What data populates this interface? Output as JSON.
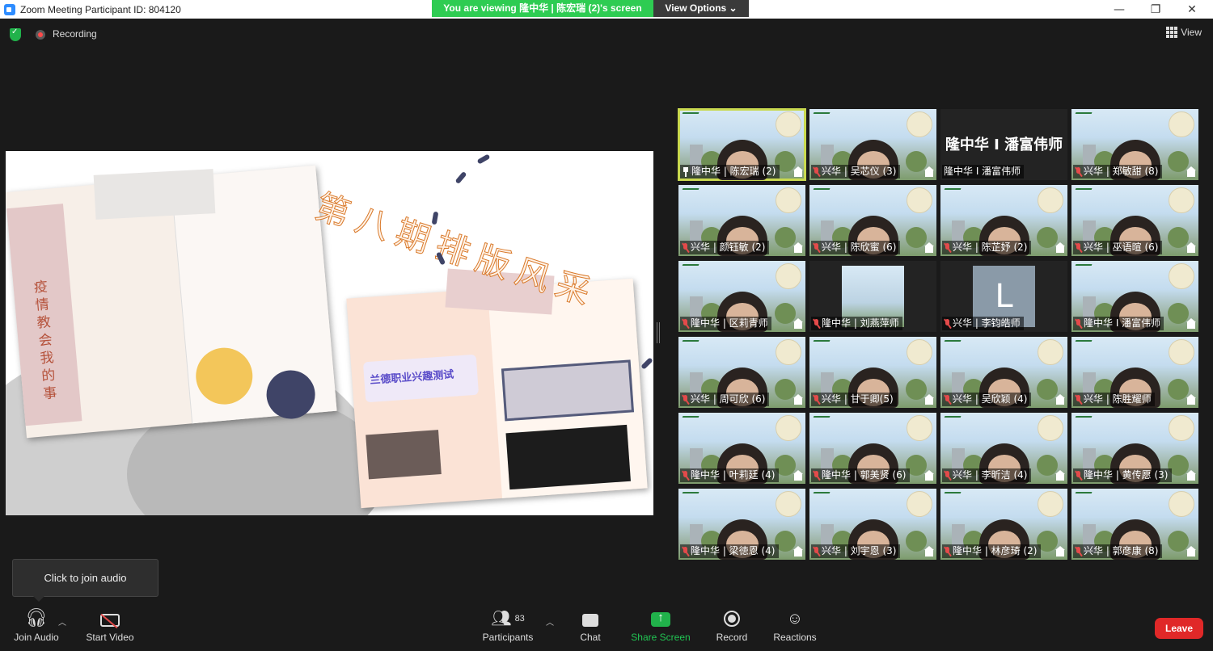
{
  "window": {
    "title": "Zoom Meeting Participant ID: 804120",
    "viewing_banner": "You are viewing 隆中华 | 陈宏瑞 (2)'s screen",
    "view_options": "View Options ⌄",
    "minimize": "—",
    "restore": "❐",
    "close": "✕"
  },
  "status": {
    "recording": "Recording",
    "view": "View"
  },
  "shared_screen": {
    "headline": "第八期排版风采",
    "left_vertical_text": "疫情教会我的事",
    "right_title": "兰德职业兴趣测试"
  },
  "gallery": [
    {
      "label": "隆中华 | 陈宏瑞 (2)",
      "type": "video",
      "icon": "pin",
      "selected": true
    },
    {
      "label": "兴华 | 吴芯仪 (3)",
      "type": "video",
      "icon": "muted"
    },
    {
      "label": "隆中华 I 潘富伟师",
      "type": "name",
      "big": "隆中华 I 潘富伟师"
    },
    {
      "label": "兴华 | 郑敏甜 (8)",
      "type": "video",
      "icon": "muted"
    },
    {
      "label": "兴华 | 颜钰敏 (2)",
      "type": "video",
      "icon": "muted"
    },
    {
      "label": "兴华 | 陈欣蜜 (6)",
      "type": "video",
      "icon": "muted"
    },
    {
      "label": "兴华 | 陈芷妤 (2)",
      "type": "video",
      "icon": "muted"
    },
    {
      "label": "兴华 | 巫语暄 (6)",
      "type": "video",
      "icon": "muted"
    },
    {
      "label": "隆中华 | 区莉青师",
      "type": "video",
      "icon": "muted"
    },
    {
      "label": "隆中华 | 刘燕萍师",
      "type": "thumb",
      "icon": "muted"
    },
    {
      "label": "兴华 | 李钧皓师",
      "type": "avatar",
      "icon": "muted",
      "avatar_letter": "L"
    },
    {
      "label": "隆中华 I 潘富伟师",
      "type": "video",
      "icon": "muted"
    },
    {
      "label": "兴华 | 周可欣 (6)",
      "type": "video",
      "icon": "muted"
    },
    {
      "label": "兴华 | 甘于卿(5)",
      "type": "video",
      "icon": "muted"
    },
    {
      "label": "兴华 | 吴欣颖 (4)",
      "type": "video",
      "icon": "muted"
    },
    {
      "label": "兴华 | 陈胜耀师",
      "type": "video",
      "icon": "muted"
    },
    {
      "label": "隆中华 | 叶莉廷 (4)",
      "type": "video",
      "icon": "muted"
    },
    {
      "label": "隆中华 | 郭美贤 (6)",
      "type": "video",
      "icon": "muted"
    },
    {
      "label": "兴华 | 李昕洁 (4)",
      "type": "video",
      "icon": "muted"
    },
    {
      "label": "隆中华 | 黄传愿 (3)",
      "type": "video",
      "icon": "muted"
    },
    {
      "label": "隆中华 | 梁徳恩 (4)",
      "type": "video",
      "icon": "muted"
    },
    {
      "label": "兴华 | 刘宇恩 (3)",
      "type": "video",
      "icon": "muted"
    },
    {
      "label": "隆中华 | 林彦琦 (2)",
      "type": "video",
      "icon": "muted"
    },
    {
      "label": "兴华 | 郭彦康 (8)",
      "type": "video",
      "icon": "muted"
    }
  ],
  "tooltip": "Click to join audio",
  "toolbar": {
    "join_audio": "Join Audio",
    "start_video": "Start Video",
    "participants": "Participants",
    "participants_count": "83",
    "chat": "Chat",
    "share_screen": "Share Screen",
    "record": "Record",
    "reactions": "Reactions",
    "leave": "Leave"
  },
  "colors": {
    "accent_green": "#21b24b",
    "leave_red": "#e02828",
    "banner_green": "#2ecc52",
    "selected_outline": "#c9d94f"
  }
}
